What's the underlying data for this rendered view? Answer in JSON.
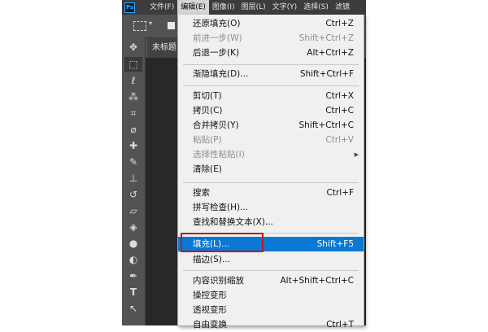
{
  "app": {
    "logo": "Ps"
  },
  "menubar": {
    "items": [
      "文件(F)",
      "编辑(E)",
      "图像(I)",
      "图层(L)",
      "文字(Y)",
      "选择(S)",
      "滤镜"
    ]
  },
  "document": {
    "tab_title": "未标题"
  },
  "toolbar": {
    "tools": [
      {
        "name": "move-icon",
        "glyph": "✥"
      },
      {
        "name": "marquee-icon",
        "glyph": "⬚"
      },
      {
        "name": "lasso-icon",
        "glyph": "ℓ"
      },
      {
        "name": "magic-wand-icon",
        "glyph": "⁂"
      },
      {
        "name": "crop-icon",
        "glyph": "⌗"
      },
      {
        "name": "eyedropper-icon",
        "glyph": "⌀"
      },
      {
        "name": "healing-brush-icon",
        "glyph": "✚"
      },
      {
        "name": "brush-icon",
        "glyph": "✎"
      },
      {
        "name": "stamp-icon",
        "glyph": "⊥"
      },
      {
        "name": "history-brush-icon",
        "glyph": "↺"
      },
      {
        "name": "eraser-icon",
        "glyph": "▱"
      },
      {
        "name": "paint-bucket-icon",
        "glyph": "◈"
      },
      {
        "name": "blur-icon",
        "glyph": "●"
      },
      {
        "name": "dodge-icon",
        "glyph": "◐"
      },
      {
        "name": "pen-icon",
        "glyph": "✒"
      },
      {
        "name": "type-icon",
        "glyph": "T"
      },
      {
        "name": "path-selection-icon",
        "glyph": "↖"
      }
    ]
  },
  "edit_menu": {
    "items": [
      {
        "label": "还原填充(O)",
        "shortcut": "Ctrl+Z",
        "disabled": false
      },
      {
        "label": "前进一步(W)",
        "shortcut": "Shift+Ctrl+Z",
        "disabled": true
      },
      {
        "label": "后退一步(K)",
        "shortcut": "Alt+Ctrl+Z",
        "disabled": false
      },
      {
        "label": "渐隐填充(D)...",
        "shortcut": "Shift+Ctrl+F",
        "disabled": false
      },
      {
        "label": "剪切(T)",
        "shortcut": "Ctrl+X",
        "disabled": false
      },
      {
        "label": "拷贝(C)",
        "shortcut": "Ctrl+C",
        "disabled": false
      },
      {
        "label": "合并拷贝(Y)",
        "shortcut": "Shift+Ctrl+C",
        "disabled": false
      },
      {
        "label": "粘贴(P)",
        "shortcut": "Ctrl+V",
        "disabled": true
      },
      {
        "label": "选择性粘贴(I)",
        "shortcut": "",
        "disabled": true
      },
      {
        "label": "清除(E)",
        "shortcut": "",
        "disabled": false
      },
      {
        "label": "搜索",
        "shortcut": "Ctrl+F",
        "disabled": false
      },
      {
        "label": "拼写检查(H)...",
        "shortcut": "",
        "disabled": false
      },
      {
        "label": "查找和替换文本(X)...",
        "shortcut": "",
        "disabled": false
      },
      {
        "label": "填充(L)...",
        "shortcut": "Shift+F5",
        "disabled": false
      },
      {
        "label": "描边(S)...",
        "shortcut": "",
        "disabled": false
      },
      {
        "label": "内容识别缩放",
        "shortcut": "Alt+Shift+Ctrl+C",
        "disabled": false
      },
      {
        "label": "操控变形",
        "shortcut": "",
        "disabled": false
      },
      {
        "label": "透视变形",
        "shortcut": "",
        "disabled": false
      },
      {
        "label": "自由变换",
        "shortcut": "Ctrl+T",
        "disabled": false
      }
    ]
  },
  "colors": {
    "highlight": "#0b78d4",
    "annotation_box": "#c21818"
  }
}
